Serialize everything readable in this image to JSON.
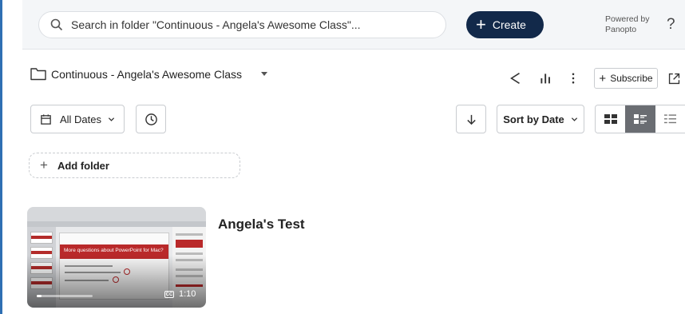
{
  "search": {
    "placeholder": "Search in folder \"Continuous  - Angela's Awesome Class\"..."
  },
  "header": {
    "create_label": "Create",
    "powered_by_line1": "Powered by",
    "powered_by_line2": "Panopto",
    "help_label": "?"
  },
  "folder": {
    "name": "Continuous  - Angela's Awesome Class"
  },
  "folder_actions": {
    "subscribe_label": "Subscribe"
  },
  "filters": {
    "date_label": "All Dates",
    "sort_label": "Sort by Date"
  },
  "add_folder": {
    "label": "Add folder"
  },
  "sessions": [
    {
      "title": "Angela's Test",
      "duration": "1:10",
      "cc_label": "CC",
      "thumbnail_slide_title": "More questions about PowerPoint for Mac?",
      "playback_progress": 0.08
    }
  ],
  "colors": {
    "create_button": "#12294a",
    "slide_accent": "#b9292a",
    "active_view": "#6a6d72",
    "frame_accent": "#2f6fb3"
  },
  "icons": [
    "search-icon",
    "plus-icon",
    "folder-icon",
    "share-icon",
    "stats-icon",
    "more-icon",
    "external-link-icon",
    "calendar-icon",
    "clock-icon",
    "arrow-down-icon",
    "grid-view-icon",
    "detail-view-icon",
    "list-view-icon"
  ]
}
